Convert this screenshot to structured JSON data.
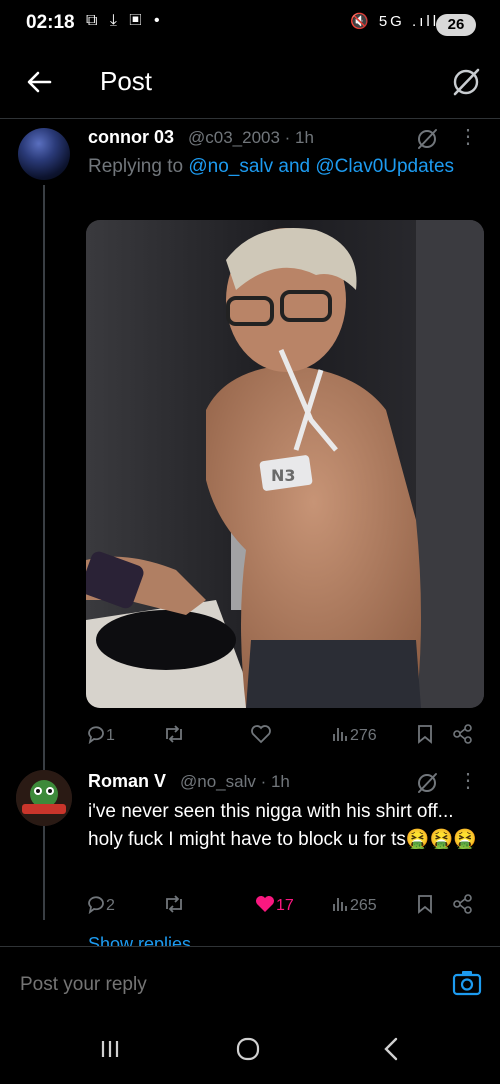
{
  "status_bar": {
    "time": "02:18",
    "left_icons": "⧉ ⤓ ▣ •",
    "signal_icons": "🔇 5G .ıll ⊘",
    "battery": "26"
  },
  "header": {
    "title": "Post"
  },
  "tweet": {
    "name": "connor 03",
    "handle": "@c03_2003 · 1h",
    "replying_prefix": "Replying to ",
    "mention1": "@no_salv",
    "and": " and ",
    "mention2": "@Clav0Updates",
    "necklace_text": "N3",
    "stats": {
      "replies": "1",
      "retweets": "",
      "likes": "",
      "views": "276"
    }
  },
  "reply": {
    "name": "Roman V",
    "handle": "@no_salv · 1h",
    "text": "i've never seen this nigga with his shirt off... holy fuck I might have to block u for ts🤮🤮🤮",
    "stats": {
      "replies": "2",
      "retweets": "",
      "likes": "17",
      "views": "265"
    },
    "show_replies": "Show replies"
  },
  "compose": {
    "placeholder": "Post your reply"
  },
  "colors": {
    "accent": "#1d9bf0",
    "like": "#f91880",
    "muted": "#71767b",
    "background": "#000000"
  },
  "icons": [
    "back-arrow-icon",
    "grok-icon",
    "more-icon",
    "reply-icon",
    "retweet-icon",
    "like-icon",
    "views-icon",
    "bookmark-icon",
    "share-icon",
    "camera-icon"
  ]
}
